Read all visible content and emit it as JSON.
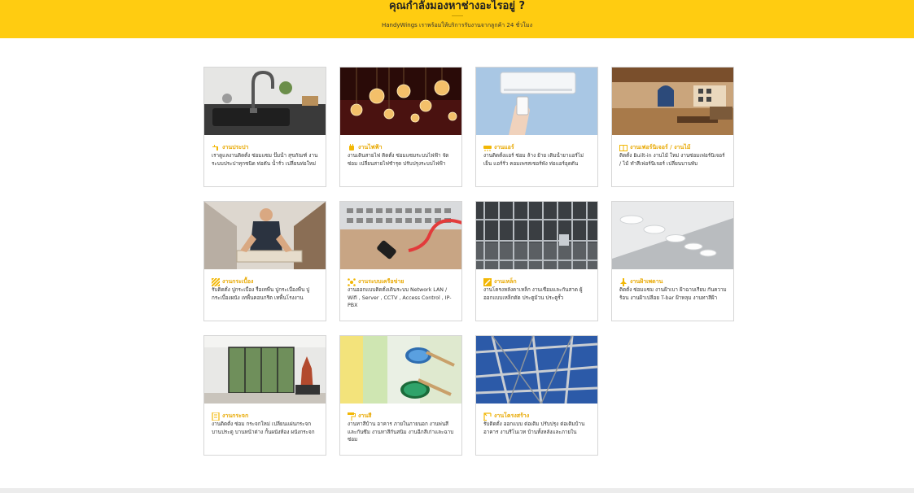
{
  "header": {
    "title": "คุณกำลังมองหาช่างอะไรอยู่ ?",
    "subtitle": "HandyWings เราพร้อมให้บริการรับงานจากลูกค้า 24 ชั่วโมง"
  },
  "colors": {
    "accent": "#ffcc11",
    "title_text": "#e8a800"
  },
  "services": [
    {
      "title": "งานประปา",
      "icon": "faucet-icon",
      "image": "kitchen-sink-faucet",
      "description": "เราดูแลงานติดตั้ง ซ่อมแซม ปั๊มน้ำ สุขภัณฑ์ งานระบบประปาทุกชนิด ท่อตัน น้ำรั่ว เปลี่ยนท่อใหม่"
    },
    {
      "title": "งานไฟฟ้า",
      "icon": "plug-icon",
      "image": "hanging-light-bulbs",
      "description": "งานเดินสายไฟ ติดตั้ง ซ่อมแซมระบบไฟฟ้า จัดซ่อม เปลี่ยนสายไฟชำรุด ปรับปรุงระบบไฟฟ้า"
    },
    {
      "title": "งานแอร์",
      "icon": "air-conditioner-icon",
      "image": "air-conditioner-remote",
      "description": "งานติดตั้งแอร์ ซ่อม ล้าง ย้าย เติมน้ำยาแอร์ไม่เย็น แอร์รั่ว คอมเพรสเซอร์พัง ท่อแอร์อุดตัน"
    },
    {
      "title": "งานเฟอร์นิเจอร์ / งานไม้",
      "icon": "furniture-icon",
      "image": "wooden-living-room",
      "description": "ติดตั้ง Built-in งานไม้ ใหม่ งานซ่อมเฟอร์นิเจอร์ / ไม้ ทำสีเฟอร์นิเจอร์ เปลี่ยนบานพับ"
    },
    {
      "title": "งานกระเบื้อง",
      "icon": "tile-icon",
      "image": "worker-laying-tiles",
      "description": "รับติดตั้ง ปูกระเบื้อง รื้อเทพื้น ปูกระเบื้องพื้น ปูกระเบื้องผนัง เทพื้นคอนกรีต เทพื้นโรงงาน"
    },
    {
      "title": "งานระบบเครือข่าย",
      "icon": "network-icon",
      "image": "network-cable-switch",
      "description": "งานออกแบบติดตั้งเดินระบบ Network LAN / Wifi , Server , CCTV , Access Control , IP-PBX"
    },
    {
      "title": "งานเหล็ก",
      "icon": "steel-icon",
      "image": "steel-fence-gate",
      "description": "งานโครงหลังคาเหล็ก งานเชื่อมและกันสาด ผู้ออกแบบเหล็กดัด ประตูม้วน ประตูรั้ว"
    },
    {
      "title": "งานฝ้าเพดาน",
      "icon": "ceiling-lamp-icon",
      "image": "ceiling-lights",
      "description": "ติดตั้ง ซ่อมแซม งานฝ้าเบา ฝ้าฉาบเรียบ กันความร้อน งานฝ้าเปลือย T-bar ฝ้าหลุม งานทาสีฝ้า"
    },
    {
      "title": "งานกระจก",
      "icon": "glass-icon",
      "image": "glass-sliding-doors",
      "description": "งานติดตั้ง ซ่อม กระจกใหม่ เปลี่ยนแผ่นกระจก บานประตู บานหน้าต่าง กั้นผนังห้อง ผนังกระจก"
    },
    {
      "title": "งานสี",
      "icon": "paint-roller-icon",
      "image": "paint-brushes-cans",
      "description": "งานทาสีบ้าน อาคาร ภายในภายนอก งานพ่นสีและกันซึม งานทาสีกันสนิม งานฉีกสีเก่าและฉาบซ่อม"
    },
    {
      "title": "งานโครงสร้าง",
      "icon": "crane-icon",
      "image": "steel-structure-frame",
      "description": "รับติดตั้ง ออกแบบ ต่อเติม ปรับปรุง ต่อเติมบ้าน อาคาร งานรีโนเวท บ้านทั้งหลังและภายใน"
    }
  ]
}
